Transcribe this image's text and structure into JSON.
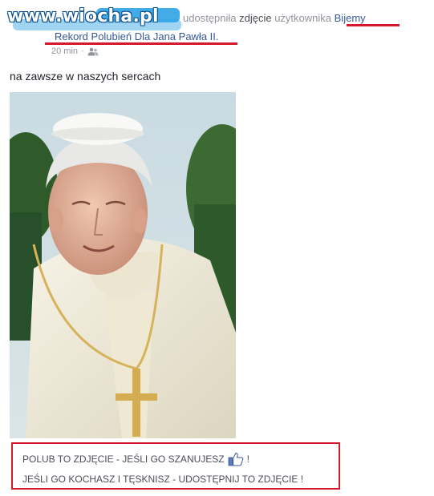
{
  "watermark": "www.wiocha.pl",
  "post": {
    "action_prefix": "udostępniła ",
    "action_object": "zdjęcie",
    "action_suffix": " użytkownika ",
    "group_name_part1": "Bijemy",
    "group_name_part2": "Rekord Polubień Dla Jana Pawła II.",
    "time": "20 min",
    "privacy_icon": "friends-icon",
    "status_text": "na zawsze w naszych sercach"
  },
  "caption": {
    "line1": "POLUB TO ZDJĘCIE - JEŚLI GO SZANUJESZ",
    "line1_icon": "thumbs-up-icon",
    "line1_suffix": "!",
    "line2": "JEŚLI GO KOCHASZ I TĘSKNISZ - UDOSTĘPNIJ TO ZDJĘCIE !"
  },
  "colors": {
    "link": "#365899",
    "meta_gray": "#90949c",
    "highlight_red": "#d6182c",
    "redaction_blue": "#2fa3e6"
  }
}
